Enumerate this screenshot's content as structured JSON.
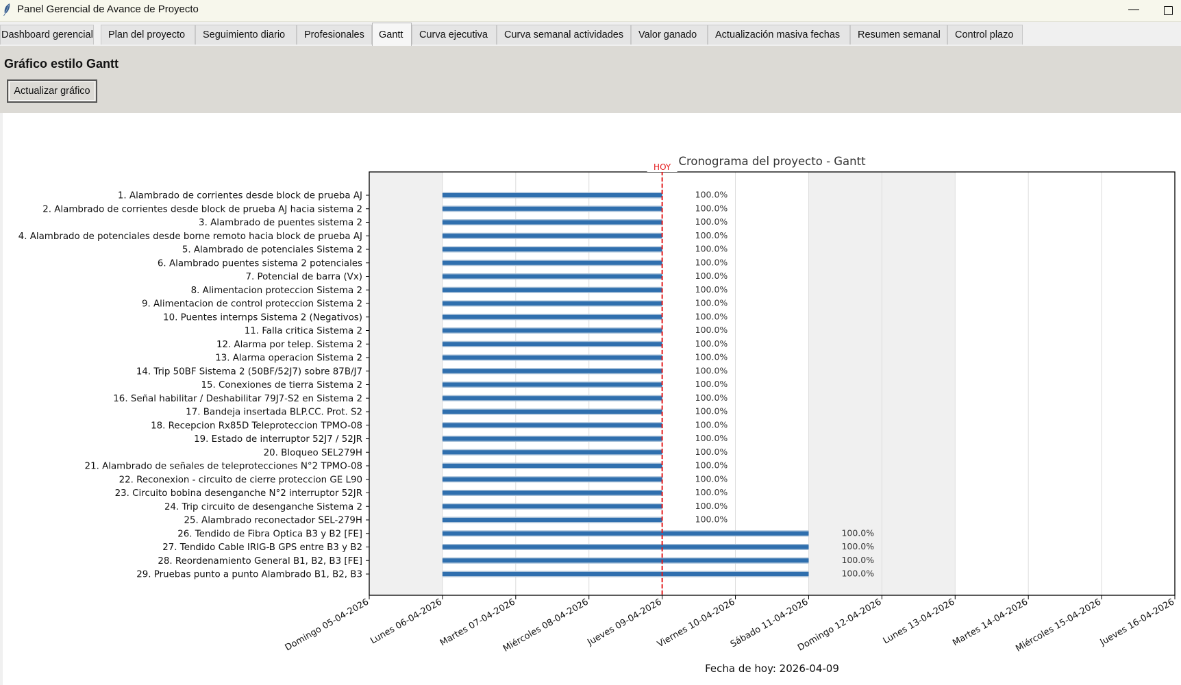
{
  "window": {
    "title": "Panel Gerencial de Avance de Proyecto",
    "minimize_glyph": "—"
  },
  "tabs": [
    {
      "label": "Dashboard gerencial"
    },
    {
      "label": "Plan del proyecto"
    },
    {
      "label": "Seguimiento diario"
    },
    {
      "label": "Profesionales"
    },
    {
      "label": "Gantt"
    },
    {
      "label": "Curva ejecutiva"
    },
    {
      "label": "Curva semanal actividades"
    },
    {
      "label": "Valor ganado"
    },
    {
      "label": "Actualización masiva fechas"
    },
    {
      "label": "Resumen semanal"
    },
    {
      "label": "Control plazo"
    }
  ],
  "active_tab": "Gantt",
  "panel": {
    "title": "Gráfico estilo Gantt",
    "refresh_button_label": "Actualizar gráfico"
  },
  "chart_data": {
    "type": "gantt",
    "title": "Cronograma del proyecto - Gantt",
    "xlabel": "Fecha de hoy: 2026-04-09",
    "today_label": "HOY",
    "today_index": 4,
    "x_ticks": [
      "Domingo 05-04-2026",
      "Lunes 06-04-2026",
      "Martes 07-04-2026",
      "Miércoles 08-04-2026",
      "Jueves 09-04-2026",
      "Viernes 10-04-2026",
      "Sábado 11-04-2026",
      "Domingo 12-04-2026",
      "Lunes 13-04-2026",
      "Martes 14-04-2026",
      "Miércoles 15-04-2026",
      "Jueves 16-04-2026"
    ],
    "weekend_shading": [
      [
        0,
        1
      ],
      [
        6,
        8
      ]
    ],
    "colors": {
      "bar": "#2f6fae",
      "bar_edge": "#a9c1d8",
      "today_line": "#e41a1c",
      "weekend": "#f0f0f0",
      "grid": "#dcdcdc"
    },
    "tasks": [
      {
        "label": "1. Alambrado de corrientes desde block de prueba AJ",
        "start": "06-04-2026",
        "end": "09-04-2026",
        "pct_label": "100.0%"
      },
      {
        "label": "2. Alambrado  de corrientes desde block de prueba AJ hacia sistema 2",
        "start": "06-04-2026",
        "end": "09-04-2026",
        "pct_label": "100.0%"
      },
      {
        "label": "3. Alambrado de puentes sistema 2",
        "start": "06-04-2026",
        "end": "09-04-2026",
        "pct_label": "100.0%"
      },
      {
        "label": "4. Alambrado de potenciales desde borne remoto hacia block de prueba AJ",
        "start": "06-04-2026",
        "end": "09-04-2026",
        "pct_label": "100.0%"
      },
      {
        "label": "5. Alambrado de potenciales Sistema 2",
        "start": "06-04-2026",
        "end": "09-04-2026",
        "pct_label": "100.0%"
      },
      {
        "label": "6. Alambrado puentes sistema 2 potenciales",
        "start": "06-04-2026",
        "end": "09-04-2026",
        "pct_label": "100.0%"
      },
      {
        "label": "7. Potencial de barra (Vx)",
        "start": "06-04-2026",
        "end": "09-04-2026",
        "pct_label": "100.0%"
      },
      {
        "label": "8. Alimentacion proteccion Sistema 2",
        "start": "06-04-2026",
        "end": "09-04-2026",
        "pct_label": "100.0%"
      },
      {
        "label": "9. Alimentacion de control proteccion Sistema 2",
        "start": "06-04-2026",
        "end": "09-04-2026",
        "pct_label": "100.0%"
      },
      {
        "label": "10. Puentes internps Sistema 2 (Negativos)",
        "start": "06-04-2026",
        "end": "09-04-2026",
        "pct_label": "100.0%"
      },
      {
        "label": "11. Falla critica Sistema 2",
        "start": "06-04-2026",
        "end": "09-04-2026",
        "pct_label": "100.0%"
      },
      {
        "label": "12. Alarma por telep. Sistema 2",
        "start": "06-04-2026",
        "end": "09-04-2026",
        "pct_label": "100.0%"
      },
      {
        "label": "13. Alarma operacion Sistema 2",
        "start": "06-04-2026",
        "end": "09-04-2026",
        "pct_label": "100.0%"
      },
      {
        "label": "14. Trip 50BF Sistema 2 (50BF/52J7) sobre 87B/J7",
        "start": "06-04-2026",
        "end": "09-04-2026",
        "pct_label": "100.0%"
      },
      {
        "label": "15. Conexiones de tierra Sistema 2",
        "start": "06-04-2026",
        "end": "09-04-2026",
        "pct_label": "100.0%"
      },
      {
        "label": "16. Señal habilitar / Deshabilitar 79J7-S2 en Sistema 2",
        "start": "06-04-2026",
        "end": "09-04-2026",
        "pct_label": "100.0%"
      },
      {
        "label": "17. Bandeja insertada BLP.CC. Prot. S2",
        "start": "06-04-2026",
        "end": "09-04-2026",
        "pct_label": "100.0%"
      },
      {
        "label": "18. Recepcion Rx85D Teleproteccion TPMO-08",
        "start": "06-04-2026",
        "end": "09-04-2026",
        "pct_label": "100.0%"
      },
      {
        "label": "19. Estado de interruptor 52J7 / 52JR",
        "start": "06-04-2026",
        "end": "09-04-2026",
        "pct_label": "100.0%"
      },
      {
        "label": "20. Bloqueo SEL279H",
        "start": "06-04-2026",
        "end": "09-04-2026",
        "pct_label": "100.0%"
      },
      {
        "label": "21. Alambrado de señales de teleprotecciones N°2 TPMO-08",
        "start": "06-04-2026",
        "end": "09-04-2026",
        "pct_label": "100.0%"
      },
      {
        "label": "22. Reconexion - circuito de cierre proteccion GE L90",
        "start": "06-04-2026",
        "end": "09-04-2026",
        "pct_label": "100.0%"
      },
      {
        "label": "23. Circuito bobina desenganche N°2 interruptor 52JR",
        "start": "06-04-2026",
        "end": "09-04-2026",
        "pct_label": "100.0%"
      },
      {
        "label": "24. Trip circuito de desenganche Sistema 2",
        "start": "06-04-2026",
        "end": "09-04-2026",
        "pct_label": "100.0%"
      },
      {
        "label": "25. Alambrado reconectador SEL-279H",
        "start": "06-04-2026",
        "end": "09-04-2026",
        "pct_label": "100.0%"
      },
      {
        "label": "26. Tendido de Fibra Optica B3 y B2 [FE]",
        "start": "06-04-2026",
        "end": "11-04-2026",
        "pct_label": "100.0%"
      },
      {
        "label": "27. Tendido Cable IRIG-B GPS entre B3 y B2",
        "start": "06-04-2026",
        "end": "11-04-2026",
        "pct_label": "100.0%"
      },
      {
        "label": "28. Reordenamiento General B1, B2, B3 [FE]",
        "start": "06-04-2026",
        "end": "11-04-2026",
        "pct_label": "100.0%"
      },
      {
        "label": "29. Pruebas punto a punto Alambrado B1, B2, B3",
        "start": "06-04-2026",
        "end": "11-04-2026",
        "pct_label": "100.0%"
      }
    ]
  }
}
